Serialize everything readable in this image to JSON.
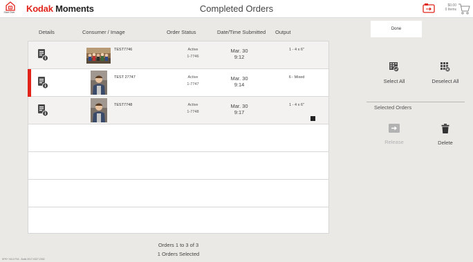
{
  "header": {
    "start_over": "Start Over",
    "brand_kodak": "Kodak",
    "brand_moments": "Moments",
    "title": "Completed Orders",
    "cart_amount": "$0.00",
    "cart_items": "0 Items"
  },
  "columns": {
    "details": "Details",
    "consumer": "Consumer / Image",
    "status": "Order Status",
    "datetime": "Date/Time Submitted",
    "output": "Output"
  },
  "orders": [
    {
      "name": "TEST7746",
      "status": "Active",
      "order_id": "1-7746",
      "date": "Mar. 30",
      "time": "9:12",
      "output": "1 - 4 x 6\"",
      "selected": false
    },
    {
      "name": "TEST 27747",
      "status": "Active",
      "order_id": "1-7747",
      "date": "Mar. 30",
      "time": "9:14",
      "output": "6 - Mixed",
      "selected": true
    },
    {
      "name": "TEST7748",
      "status": "Active",
      "order_id": "1-7748",
      "date": "Mar. 30",
      "time": "9:17",
      "output": "1 - 4 x 6\"",
      "selected": false
    }
  ],
  "footer": {
    "range": "Orders 1 to 3 of 3",
    "selected_count": "1 Orders Selected",
    "version": "KPK+ V6.0.P16 - Build 2017.0327.2302"
  },
  "panel": {
    "done": "Done",
    "select_all": "Select All",
    "deselect_all": "Deselect All",
    "selected_orders": "Selected Orders",
    "release": "Release",
    "delete": "Delete"
  },
  "colors": {
    "accent": "#e2231a",
    "background": "#ebe9e6",
    "icon": "#4a4a4a",
    "disabled": "#b2b2b2"
  },
  "icons": {
    "start_over": "house-icon",
    "camera": "camera-icon",
    "cart": "cart-icon",
    "details": "document-info-icon",
    "select_all": "calendar-check-icon",
    "deselect_all": "grid-x-icon",
    "release": "release-arrow-icon",
    "delete": "trash-icon"
  }
}
